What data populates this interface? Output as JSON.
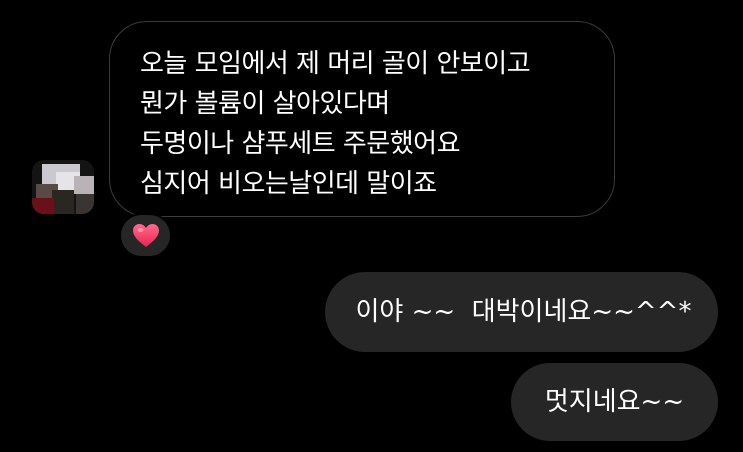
{
  "conversation": {
    "received": {
      "lines": [
        "오늘 모임에서 제 머리 골이 안보이고",
        "뭔가 볼륨이 살아있다며",
        "두명이나 샴푸세트 주문했어요",
        "심지어 비오는날인데 말이죠"
      ],
      "reaction_icon": "heart-icon",
      "reaction_color": "#ff3b6b"
    },
    "sent": [
      {
        "text": "이야 ~~  대박이네요~~^^*"
      },
      {
        "text": "멋지네요~~"
      }
    ]
  },
  "theme": {
    "background": "#000000",
    "received_bubble_border": "#3b3b3b",
    "sent_bubble_background": "#262626",
    "text_color": "#ffffff",
    "avatar": "blurred-avatar"
  }
}
